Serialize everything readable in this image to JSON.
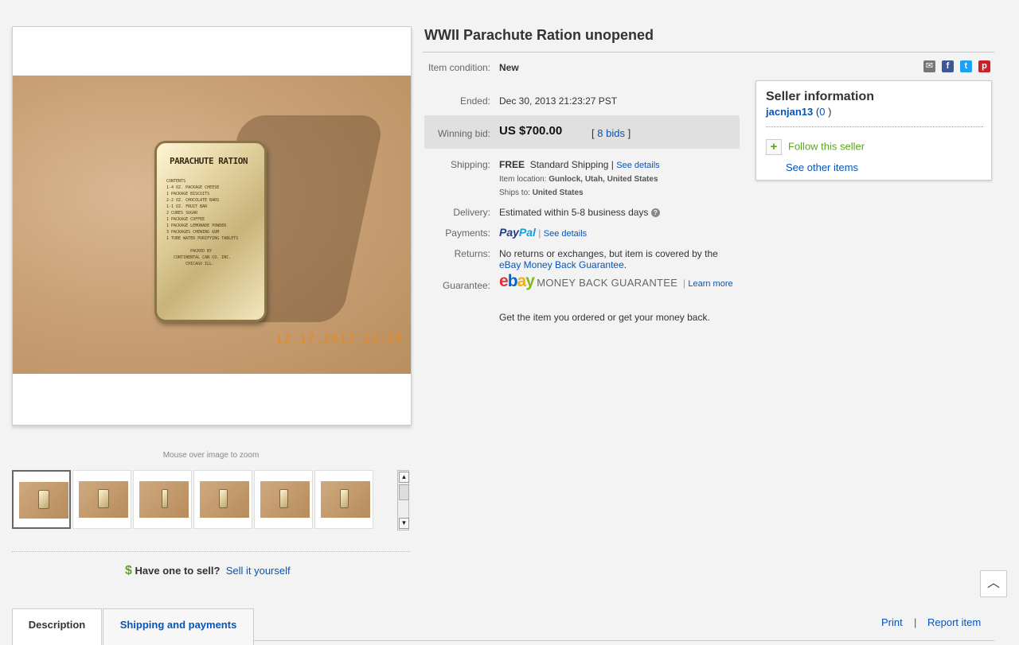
{
  "listing": {
    "title": "WWII Parachute Ration unopened",
    "zoom_hint": "Mouse over image to zoom",
    "photo": {
      "tin_title": "PARACHUTE RATION",
      "tin_contents": "CONTENTS\n1-4 OZ. PACKAGE CHEESE\n1 PACKAGE BISCUITS\n2-2 OZ. CHOCOLATE BARS\n1-1 OZ. FRUIT BAR\n2 CUBES SUGAR\n1 PACKAGE COFFEE\n1 PACKAGE LEMONADE POWDER\n3 PACKAGES CHEWING GUM\n1 TUBE WATER PURIFYING TABLETS\n\n          PACKED BY\n   CONTINENTAL CAN CO. INC.\n        CHICAGO ILL.",
      "date_stamp": "12.17.2013  23:35"
    },
    "thumbnails_count": 6
  },
  "details": {
    "condition_label": "Item condition:",
    "condition_value": "New",
    "ended_label": "Ended:",
    "ended_value": "Dec 30, 2013  21:23:27 PST",
    "winning_label": "Winning bid:",
    "winning_value": "US $700.00",
    "bids_open": "[",
    "bids_link": "8 bids",
    "bids_close": "]",
    "shipping_label": "Shipping:",
    "shipping_free": "FREE",
    "shipping_method": "Standard Shipping |",
    "see_details": "See details",
    "item_location_label": "Item location:",
    "item_location": "Gunlock, Utah, United States",
    "ships_to_label": "Ships to:",
    "ships_to": "United States",
    "delivery_label": "Delivery:",
    "delivery_value": "Estimated within 5-8 business days",
    "payments_label": "Payments:",
    "paypal_pay": "Pay",
    "paypal_pal": "Pal",
    "payments_see_details": "See details",
    "returns_label": "Returns:",
    "returns_text": "No returns or exchanges, but item is covered by the",
    "returns_link": "eBay Money Back Guarantee",
    "guarantee_label": "Guarantee:",
    "mbg_text": "MONEY BACK GUARANTEE",
    "learn_more": "Learn more",
    "guarantee_note": "Get the item you ordered or get your money back."
  },
  "seller": {
    "heading": "Seller information",
    "name": "jacnjan13",
    "feedback_open": "(",
    "feedback": "0",
    "feedback_close": ")",
    "follow": "Follow this seller",
    "other_items": "See other items"
  },
  "sell_promo": {
    "dollar": "$",
    "question": "Have one to sell?",
    "link": "Sell it yourself"
  },
  "tabs": [
    {
      "label": "Description"
    },
    {
      "label": "Shipping and payments"
    }
  ],
  "footer": {
    "print": "Print",
    "separator": "|",
    "report": "Report item"
  },
  "colors": {
    "link": "#0654ba",
    "green": "#5ba71b",
    "bid_box": "#e0e0e0"
  }
}
